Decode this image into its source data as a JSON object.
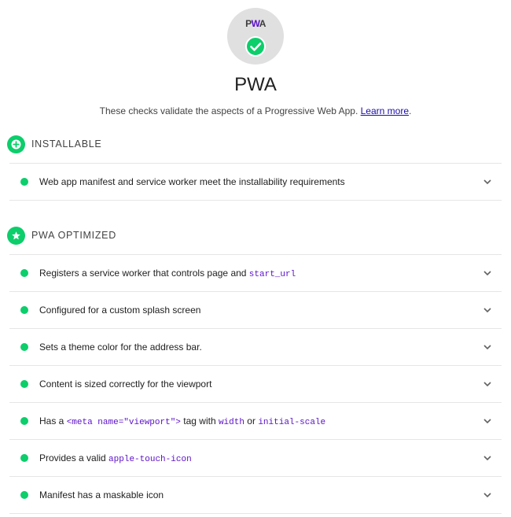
{
  "category": {
    "logo_text_left": "P",
    "logo_text_mid": "W",
    "logo_text_right": "A",
    "title": "PWA",
    "description": "These checks validate the aspects of a Progressive Web App. ",
    "learn_more": "Learn more",
    "period": "."
  },
  "colors": {
    "pass": "#0cce6b",
    "code": "#5a0fc8",
    "link": "#1a0dab"
  },
  "groups": {
    "installable": {
      "title": "INSTALLABLE",
      "icon": "plus-icon",
      "audits": [
        {
          "title": "Web app manifest and service worker meet the installability requirements"
        }
      ]
    },
    "optimized": {
      "title": "PWA OPTIMIZED",
      "icon": "star-icon",
      "audits": [
        {
          "parts": [
            "Registers a service worker that controls page and ",
            "start_url"
          ]
        },
        {
          "title": "Configured for a custom splash screen"
        },
        {
          "title": "Sets a theme color for the address bar."
        },
        {
          "title": "Content is sized correctly for the viewport"
        },
        {
          "parts": [
            "Has a ",
            "<meta name=\"viewport\">",
            " tag with ",
            "width",
            " or ",
            "initial-scale"
          ]
        },
        {
          "parts": [
            "Provides a valid ",
            "apple-touch-icon"
          ]
        },
        {
          "title": "Manifest has a maskable icon"
        }
      ]
    }
  }
}
